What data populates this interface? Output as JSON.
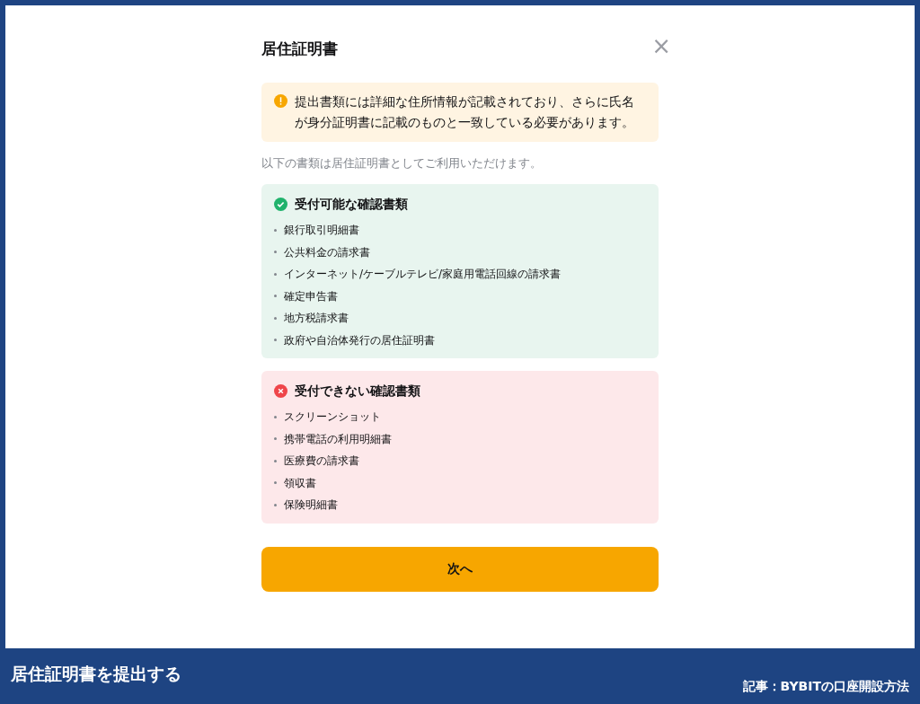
{
  "dialog": {
    "title": "居住証明書",
    "close": "×",
    "notice": {
      "kind": "warning",
      "text": "提出書類には詳細な住所情報が記載されており、さらに氏名が身分証明書に記載のものと一致している必要があります。"
    },
    "intro": "以下の書類は居住証明書としてご利用いただけます。",
    "sections": [
      {
        "kind": "accepted",
        "title": "受付可能な確認書類",
        "items": [
          "銀行取引明細書",
          "公共料金の請求書",
          "インターネット/ケーブルテレビ/家庭用電話回線の請求書",
          "確定申告書",
          "地方税請求書",
          "政府や自治体発行の居住証明書"
        ]
      },
      {
        "kind": "rejected",
        "title": "受付できない確認書類",
        "items": [
          "スクリーンショット",
          "携帯電話の利用明細書",
          "医療費の請求書",
          "領収書",
          "保険明細書"
        ]
      }
    ],
    "button": "次へ"
  },
  "caption": {
    "title": "居住証明書を提出する",
    "source": "記事：BYBITの口座開設方法"
  }
}
